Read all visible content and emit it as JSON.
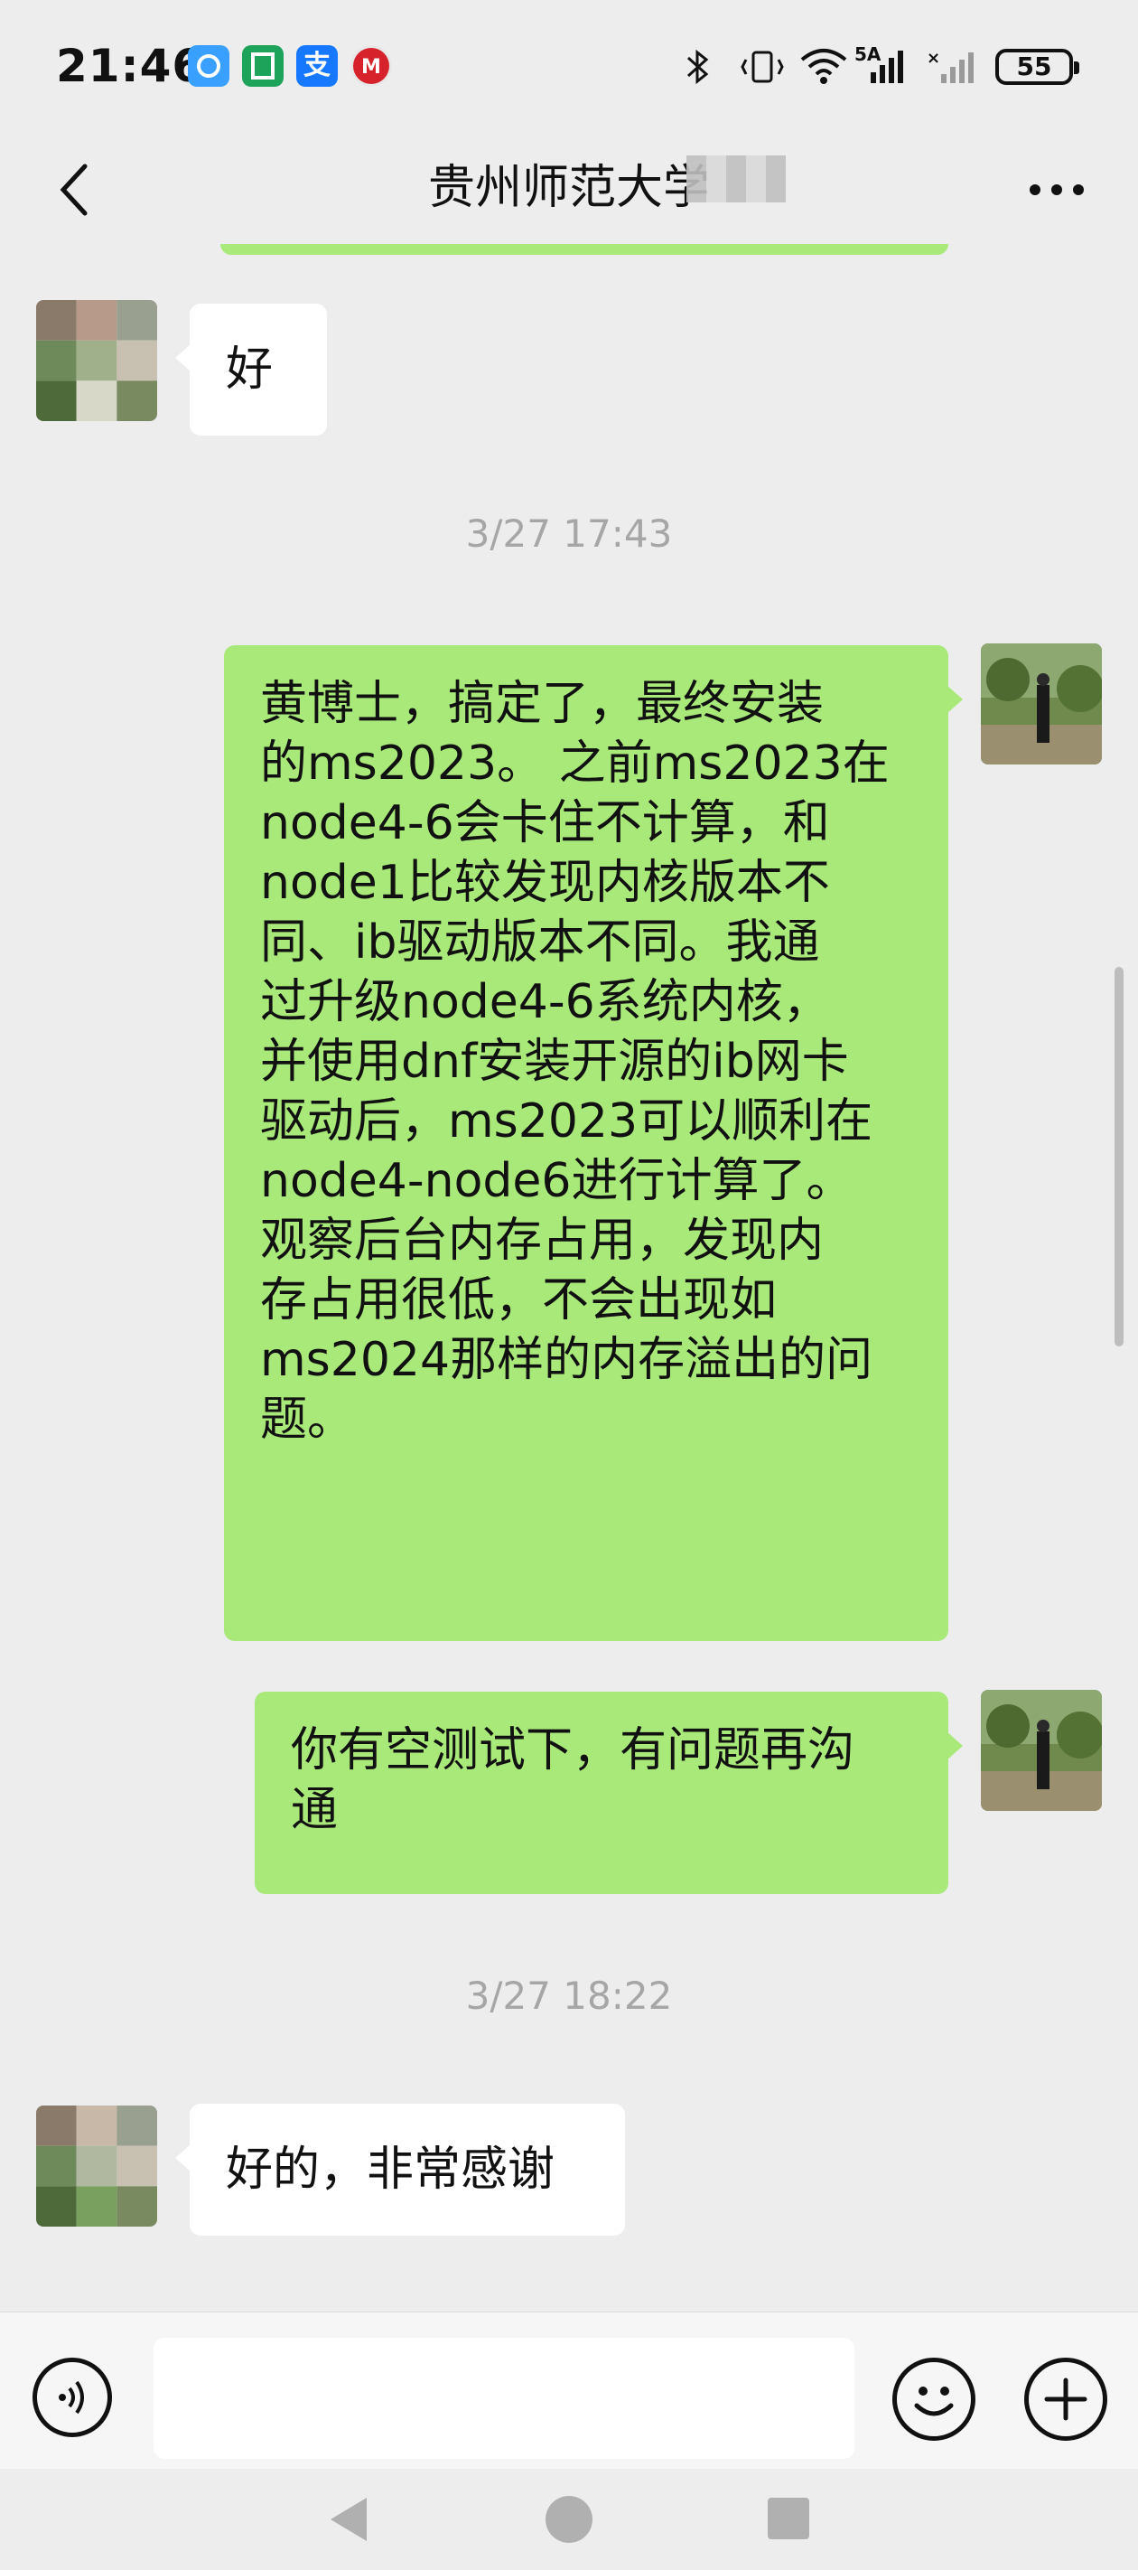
{
  "status_bar": {
    "time": "21:46",
    "network": "5A",
    "battery": "55",
    "icons": [
      "tp-link-app-icon",
      "document-app-icon",
      "alipay-app-icon",
      "bank-app-icon",
      "bluetooth-icon",
      "vibrate-icon",
      "wifi-icon",
      "signal-icon"
    ]
  },
  "header": {
    "title": "贵州师范大学",
    "back_icon": "chevron-left-icon",
    "more_icon": "more-dots-icon"
  },
  "messages": [
    {
      "side": "left",
      "text": "好"
    },
    {
      "type": "time",
      "text": "3/27 17:43"
    },
    {
      "side": "right",
      "lines": [
        "黄博士，搞定了，最终安装",
        "的ms2023。 之前ms2023在",
        "node4-6会卡住不计算，和",
        "node1比较发现内核版本不",
        "同、ib驱动版本不同。我通",
        "过升级node4-6系统内核，",
        "并使用dnf安装开源的ib网卡",
        "驱动后，ms2023可以顺利在",
        "node4-node6进行计算了。",
        "观察后台内存占用，发现内",
        "存占用很低，不会出现如",
        "ms2024那样的内存溢出的问",
        "题。"
      ]
    },
    {
      "side": "right",
      "lines": [
        "你有空测试下，有问题再沟",
        "通"
      ]
    },
    {
      "type": "time",
      "text": "3/27 18:22"
    },
    {
      "side": "left",
      "text": "好的，非常感谢"
    }
  ],
  "input_bar": {
    "placeholder": "",
    "voice_icon": "voice-icon",
    "emoji_icon": "emoji-icon",
    "plus_icon": "plus-icon"
  },
  "colors": {
    "background": "#ededed",
    "sent_bubble": "#a9e97a",
    "received_bubble": "#ffffff",
    "timestamp": "#a6a6a6"
  }
}
